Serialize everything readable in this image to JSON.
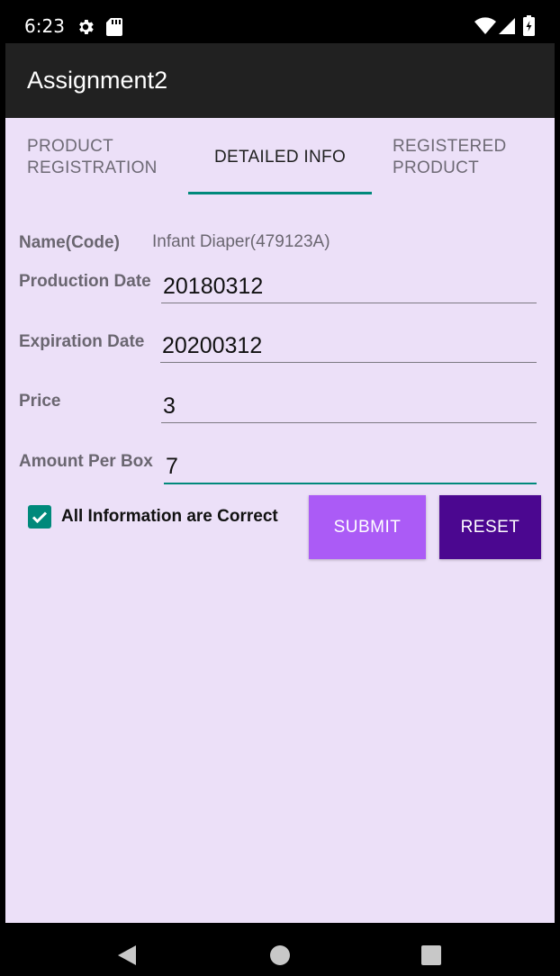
{
  "status_bar": {
    "time": "6:23",
    "icons": [
      "gear-icon",
      "sd-card-icon",
      "wifi-icon",
      "signal-icon",
      "battery-icon"
    ]
  },
  "app_bar": {
    "title": "Assignment2",
    "background": "#212121"
  },
  "tabs": [
    {
      "line1": "PRODUCT",
      "line2": "REGISTRATION",
      "active": false
    },
    {
      "line1": "DETAILED INFO",
      "line2": "",
      "active": true
    },
    {
      "line1": "REGISTERED",
      "line2": "PRODUCT",
      "active": false
    }
  ],
  "form": {
    "name": {
      "label": "Name(Code)",
      "value": "Infant Diaper(479123A)"
    },
    "production_date": {
      "label": "Production Date",
      "value": "20180312"
    },
    "expiration_date": {
      "label": "Expiration Date",
      "value": "20200312"
    },
    "price": {
      "label": "Price",
      "value": "3"
    },
    "amount_per_box": {
      "label": "Amount Per Box",
      "value": "7"
    }
  },
  "confirm": {
    "label": "All Information are Correct",
    "checked": true
  },
  "buttons": {
    "submit": "SUBMIT",
    "reset": "RESET"
  },
  "nav_bar": {
    "icons": [
      "back-icon",
      "home-icon",
      "recents-icon"
    ]
  },
  "colors": {
    "accent": "#00897b",
    "background": "#ece0f8",
    "submit": "#ab5bf6",
    "reset": "#4b0790"
  }
}
